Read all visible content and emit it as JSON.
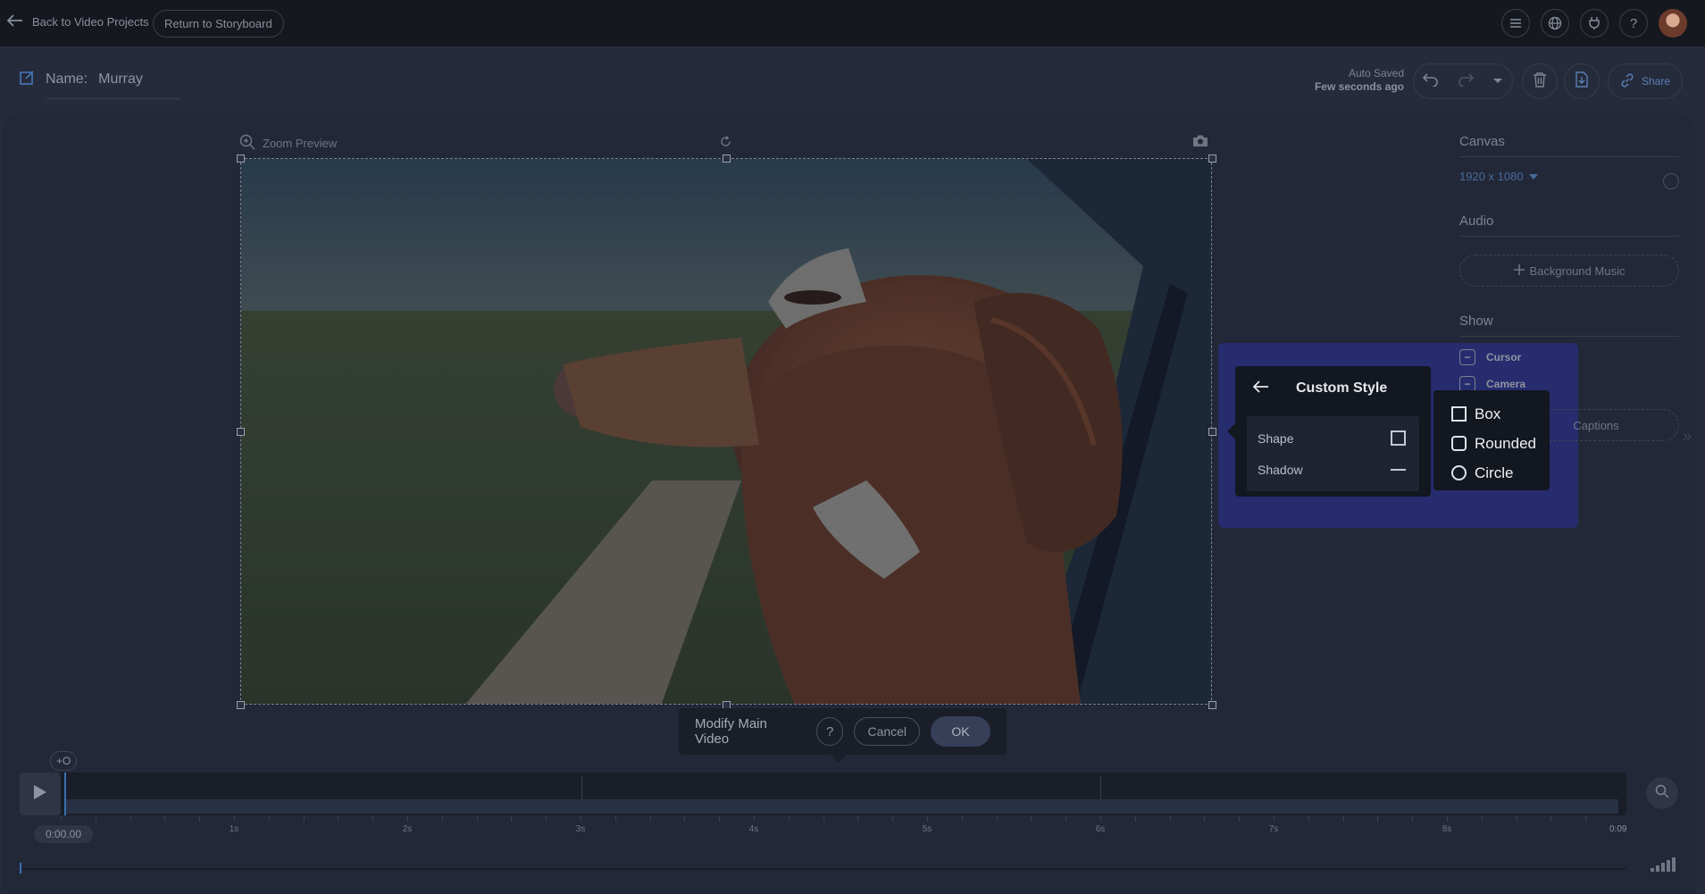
{
  "topbar": {
    "back_label": "Back to Video Projects",
    "storyboard_label": "Return to Storyboard",
    "icons": [
      "list-icon",
      "globe-icon",
      "plug-icon",
      "help-icon"
    ]
  },
  "project": {
    "name_label": "Name:",
    "name_value": "Murray"
  },
  "save": {
    "line1": "Auto Saved",
    "line2": "Few seconds ago"
  },
  "actions": {
    "share_label": "Share"
  },
  "preview": {
    "zoom_label": "Zoom Preview"
  },
  "modify_bar": {
    "label": "Modify Main Video",
    "help": "?",
    "cancel": "Cancel",
    "ok": "OK"
  },
  "side": {
    "canvas_heading": "Canvas",
    "resolution": "1920 x 1080",
    "audio_heading": "Audio",
    "background_music": "Background Music",
    "show_heading": "Show",
    "cursor_label": "Cursor",
    "camera_label": "Camera",
    "captions_label": "Captions"
  },
  "custom_style": {
    "title": "Custom Style",
    "shape_label": "Shape",
    "shadow_label": "Shadow"
  },
  "shape_menu": {
    "options": [
      "Box",
      "Rounded",
      "Circle"
    ]
  },
  "timeline": {
    "current_time": "0:00.00",
    "marker_label": "+O",
    "tick_labels": [
      "1s",
      "2s",
      "3s",
      "4s",
      "5s",
      "6s",
      "7s",
      "8s"
    ],
    "end_time": "0:09"
  },
  "colors": {
    "accent": "#3a6fb0",
    "popover_highlight": "#262c6e"
  }
}
